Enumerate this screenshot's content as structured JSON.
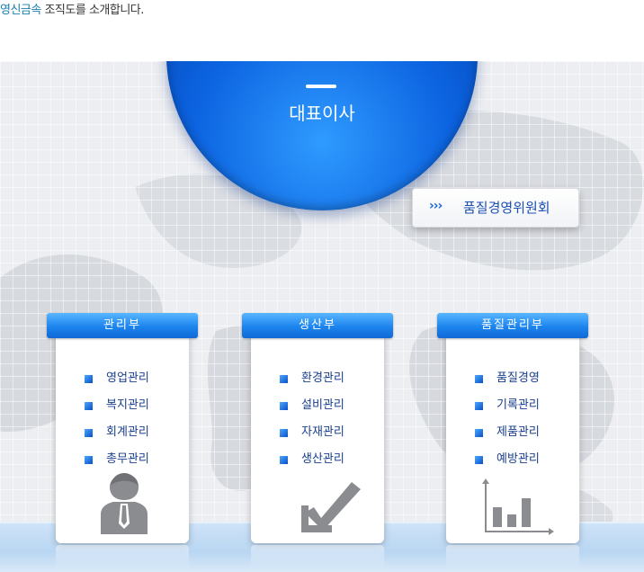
{
  "intro": {
    "brand": "영신금속",
    "text": " 조직도를 소개합니다."
  },
  "ceo": {
    "label": "대표이사"
  },
  "committee": {
    "arrows": "›››",
    "label": "품질경영위원회"
  },
  "departments": [
    {
      "title": "관리부",
      "items": [
        "영업관리",
        "복지관리",
        "회계관리",
        "총무관리"
      ],
      "icon": "person-icon"
    },
    {
      "title": "생산부",
      "items": [
        "환경관리",
        "설비관리",
        "자재관리",
        "생산관리"
      ],
      "icon": "checkmark-icon"
    },
    {
      "title": "품질관리부",
      "items": [
        "품질경영",
        "기록관리",
        "제품관리",
        "예방관리"
      ],
      "icon": "bar-chart-icon"
    }
  ],
  "colors": {
    "accent": "#0c63e0",
    "header": "#1c84ee",
    "item_text": "#1a3f8c",
    "icon_gray": "#8a8c90"
  }
}
